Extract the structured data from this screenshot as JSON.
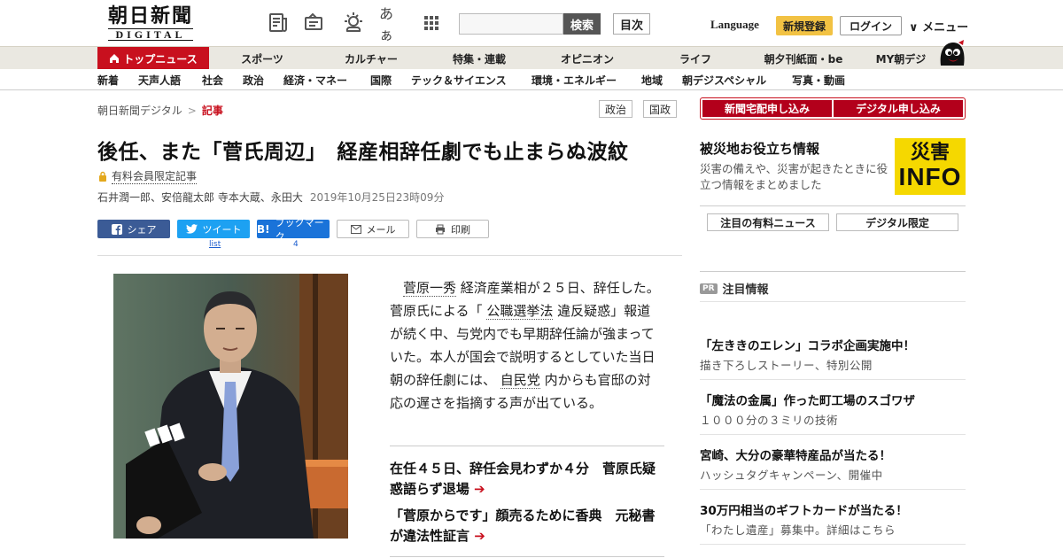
{
  "header": {
    "logo_main": "朝日新聞",
    "logo_sub": "DIGITAL",
    "icons": [
      "newspaper-icon",
      "megaphone-icon",
      "weather-icon",
      "font-size-icon",
      "grid-icon"
    ],
    "font_icon_text": "あぁ",
    "search_placeholder": "",
    "search_label": "検索",
    "toc_label": "目次",
    "language_label": "Language",
    "signup_label": "新規登録",
    "login_label": "ログイン",
    "menu_label": "∨ メニュー"
  },
  "nav_primary": [
    "トップニュース",
    "スポーツ",
    "カルチャー",
    "特集・連載",
    "オピニオン",
    "ライフ",
    "朝夕刊紙面・be",
    "MY朝デジ"
  ],
  "nav_secondary": [
    "新着",
    "天声人語",
    "社会",
    "政治",
    "経済・マネー",
    "国際",
    "テック＆サイエンス",
    "環境・エネルギー",
    "地域",
    "朝デジスペシャル",
    "写真・動画"
  ],
  "breadcrumb": {
    "home": "朝日新聞デジタル",
    "separator": ">",
    "current": "記事"
  },
  "tags": [
    "政治",
    "国政"
  ],
  "article": {
    "headline": "後任、また「菅氏周辺」　経産相辞任劇でも止まらぬ波紋",
    "members_only": "有料会員限定記事",
    "authors": "石井潤一郎、安倍龍太郎 寺本大蔵、永田大",
    "date": "2019年10月25日23時09分",
    "lead_parts": [
      "菅原一秀",
      " 経済産業相が２５日、辞任した。菅原氏による「 ",
      "公職選挙法",
      " 違反疑惑」報道が続く中、与党内でも早期辞任論が強まっていた。本人が国会で説明するとしていた当日朝の辞任劇には、 ",
      "自民党",
      " 内からも官邸の対応の遅さを指摘する声が出ている。"
    ],
    "related": [
      "在任４５日、辞任会見わずか４分　菅原氏疑惑語らず退場",
      "「菅原からです」顔売るために香典　元秘書が違法性証言"
    ],
    "arrow": "➔"
  },
  "share": {
    "facebook": "シェア",
    "twitter": "ツイート",
    "twitter_count": "list",
    "hatena": "ブックマーク",
    "hatena_count": "4",
    "mail": "メール",
    "print": "印刷"
  },
  "sidebar": {
    "cta_delivery": "新聞宅配申し込み",
    "cta_digital": "デジタル申し込み",
    "disaster_title": "被災地お役立ち情報",
    "disaster_desc": "災害の備えや、災害が起きたときに役立つ情報をまとめました",
    "badge_line1": "災害",
    "badge_line2": "INFO",
    "link_paid_news": "注目の有料ニュース",
    "link_digital_only": "デジタル限定",
    "pr_badge": "PR",
    "pr_heading": "注目情報",
    "pr_items": [
      {
        "title": "「左ききのエレン」コラボ企画実施中！",
        "sub": "描き下ろしストーリー、特別公開"
      },
      {
        "title": "「魔法の金属」作った町工場のスゴワザ",
        "sub": "１０００分の３ミリの技術"
      },
      {
        "title": "宮崎、大分の豪華特産品が当たる！",
        "sub": "ハッシュタグキャンペーン、開催中"
      },
      {
        "title": "30万円相当のギフトカードが当たる！",
        "sub": "「わたし遺産」募集中。詳細はこちら"
      }
    ]
  },
  "colors": {
    "brand_red": "#c8101e",
    "nav_bg": "#eae8e1",
    "signup_yellow": "#f2c243",
    "badge_yellow": "#f5d800"
  }
}
